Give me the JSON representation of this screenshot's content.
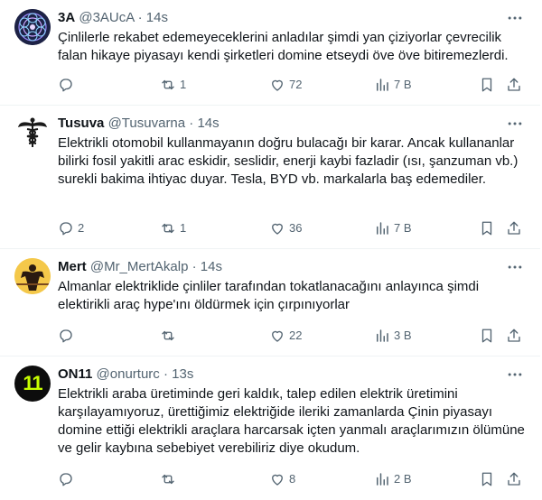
{
  "tweets": [
    {
      "name": "3A",
      "handle": "@3AUcA",
      "time": "14s",
      "avatar_icon": "mandala-avatar",
      "text": "Çinlilerle rekabet edemeyeceklerini anladılar şimdi yan çiziyorlar çevrecilik falan hikaye piyasayı kendi şirketleri domine etseydi öve öve bitiremezlerdi.",
      "replies": "",
      "retweets": "1",
      "likes": "72",
      "views": "7 B"
    },
    {
      "name": "Tusuva",
      "handle": "@Tusuvarna",
      "time": "14s",
      "avatar_icon": "caduceus-avatar",
      "text": "Elektrikli otomobil kullanmayanın doğru bulacağı bir karar. Ancak kullananlar bilirki fosil yakitli arac eskidir, seslidir, enerji kaybi fazladir (ısı, şanzuman vb.) surekli bakima ihtiyac duyar. Tesla, BYD vb. markalarla baş edemediler.",
      "replies": "2",
      "retweets": "1",
      "likes": "36",
      "views": "7 B"
    },
    {
      "name": "Mert",
      "handle": "@Mr_MertAkalp",
      "time": "14s",
      "avatar_icon": "bodybuilder-avatar",
      "text": "Almanlar elektriklide çinliler tarafından tokatlanacağını anlayınca şimdi elektirikli araç hype'ını öldürmek için çırpınıyorlar",
      "replies": "",
      "retweets": "",
      "likes": "22",
      "views": "3 B"
    },
    {
      "name": "ON11",
      "handle": "@onurturc",
      "time": "13s",
      "avatar_icon": "number-11-avatar",
      "avatar_text": "11",
      "text": "Elektrikli araba üretiminde geri kaldık, talep edilen elektrik üretimini karşılayamıyoruz, ürettiğimiz elektriğide ileriki zamanlarda Çinin piyasayı domine ettiği elektrikli araçlara harcarsak içten yanmalı araçlarımızın ölümüne ve gelir kaybına sebebiyet verebiliriz diye okudum.",
      "replies": "",
      "retweets": "",
      "likes": "8",
      "views": "2 B"
    }
  ],
  "separator": "·",
  "colors": {
    "text": "#0f1419",
    "secondary": "#536471",
    "divider": "#eff3f4"
  }
}
